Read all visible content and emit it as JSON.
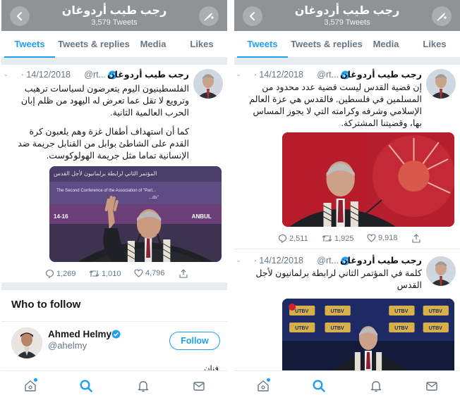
{
  "left": {
    "header": {
      "title": "رجب طيب أردوغان",
      "subtitle": "3,579 Tweets"
    },
    "tabs": [
      "Tweets",
      "Tweets & replies",
      "Media",
      "Likes"
    ],
    "tweet": {
      "name": "رجب طيب أردوغان",
      "handle": "@rt...",
      "date": "· 14/12/2018",
      "lines": [
        "الفلسطينيون اليوم يتعرضون لسياسات ترهيب",
        "وترويع لا تقل عما تعرض له اليهود من ظلم إبان",
        "الحرب العالمية الثانية.",
        "",
        "كما أن استهداف أطفال غزة وهم يلعبون كرة",
        "القدم على الشاطئ بوابل من القنابل جريمة ضد",
        "الإنسانية تماما مثل جريمة الهولوكوست."
      ],
      "media": {
        "banner_line1": "The Second Conference of the Association of \"Parl...",
        "banner_line2": "...ds\"",
        "banner_arabic": "المؤتمر الثاني لرابطة برلمانيون لأجل القدس",
        "date_text": "14-16",
        "city_text": "ANBUL"
      },
      "replies": "1,269",
      "retweets": "1,010",
      "likes": "4,796"
    },
    "who_to_follow": {
      "title": "Who to follow",
      "name": "Ahmed Helmy",
      "handle": "@ahelmy",
      "follow_label": "Follow",
      "bio": "فنان"
    }
  },
  "right": {
    "header": {
      "title": "رجب طيب أردوغان",
      "subtitle": "3,579 Tweets"
    },
    "tabs": [
      "Tweets",
      "Tweets & replies",
      "Media",
      "Likes"
    ],
    "tweet1": {
      "name": "رجب طيب أردوغان",
      "handle": "@rt...",
      "date": "· 14/12/2018",
      "lines": [
        "إن قضية القدس ليست قضية عدد محدود من",
        "المسلمين في فلسطين. فالقدس هي عزة العالم",
        "الإسلامي وشرفه وكرامته التي لا يجوز المساس",
        "بها، وقضيتنا المشتركة."
      ],
      "replies": "2,511",
      "retweets": "1,925",
      "likes": "9,918"
    },
    "tweet2": {
      "name": "رجب طيب أردوغان",
      "handle": "@rt...",
      "date": "· 14/12/2018",
      "lines": [
        "كلمة في المؤتمر الثاني لرابطة برلمانيون لأجل",
        "القدس"
      ],
      "media": {
        "logo_text": "UTBV"
      }
    }
  },
  "colors": {
    "header_bg": "#8f9396",
    "accent": "#1da1f2",
    "secondary_text": "#657786",
    "separator": "#e6ecf0"
  },
  "icons": [
    "back-arrow-icon",
    "compose-feather-icon",
    "verified-badge-icon",
    "reply-icon",
    "retweet-icon",
    "like-heart-icon",
    "share-icon",
    "home-icon",
    "search-icon",
    "notifications-bell-icon",
    "messages-envelope-icon"
  ]
}
